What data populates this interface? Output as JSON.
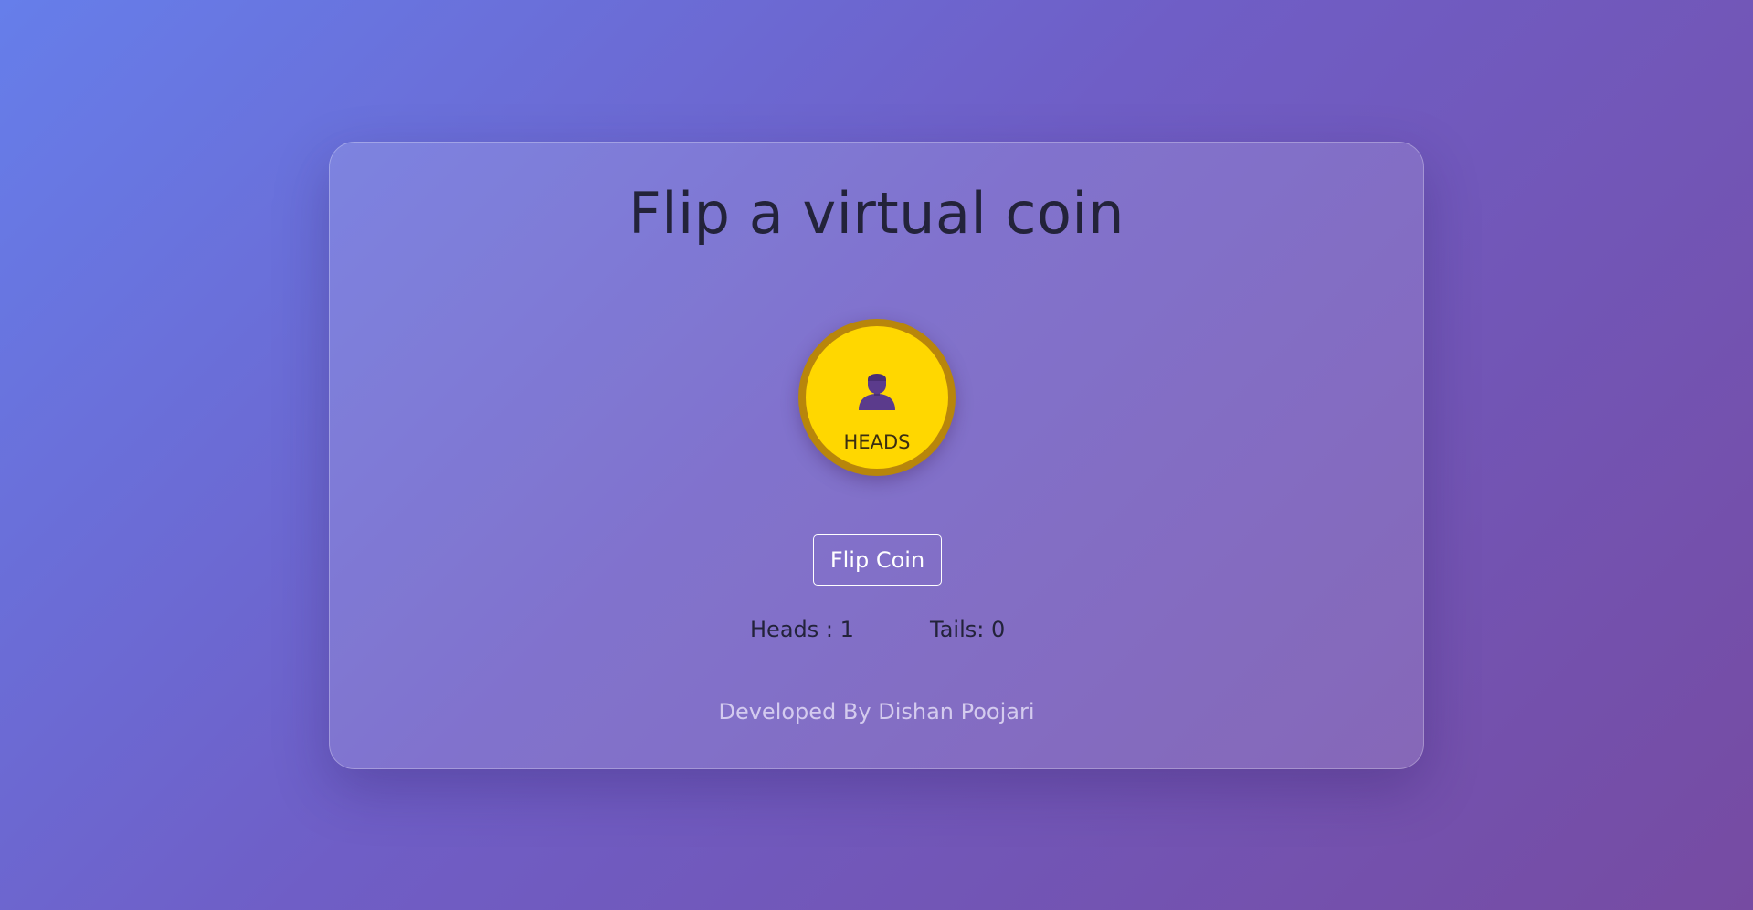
{
  "app": {
    "title": "Flip a virtual coin"
  },
  "coin": {
    "face": "HEADS",
    "icon": "person-icon",
    "face_color": "#ffd700",
    "rim_color": "#b8860b"
  },
  "controls": {
    "flip_label": "Flip Coin"
  },
  "score": {
    "heads_label": "Heads : 1",
    "tails_label": "Tails: 0",
    "heads": 1,
    "tails": 0
  },
  "footer": {
    "credit": "Developed By Dishan Poojari"
  },
  "colors": {
    "background_start": "#667eea",
    "background_end": "#764ba2",
    "text_dark": "#23233a",
    "button_text": "#ffffff"
  }
}
